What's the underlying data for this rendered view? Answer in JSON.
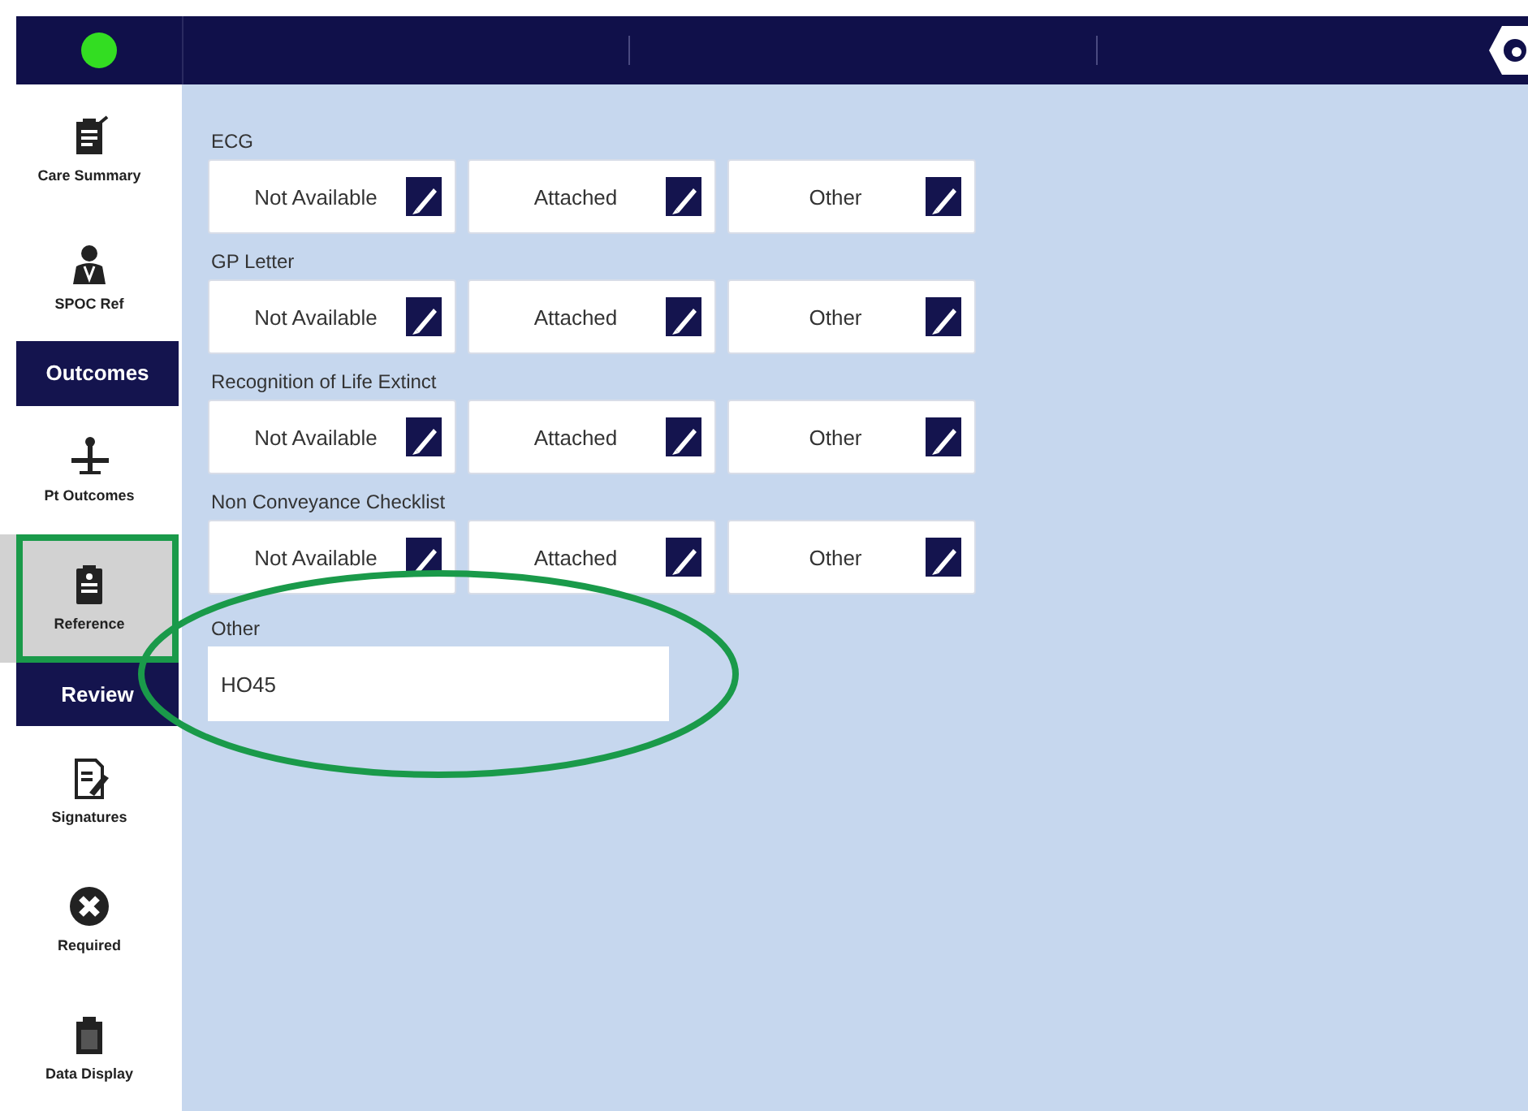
{
  "header": {
    "status_on": true
  },
  "sidebar": {
    "items": [
      {
        "kind": "item",
        "label": "Care Summary",
        "selected": false,
        "circled": false
      },
      {
        "kind": "item",
        "label": "SPOC Ref",
        "selected": false,
        "circled": false
      },
      {
        "kind": "header",
        "label": "Outcomes"
      },
      {
        "kind": "item",
        "label": "Pt Outcomes",
        "selected": false,
        "circled": false
      },
      {
        "kind": "item",
        "label": "Reference",
        "selected": true,
        "circled": true
      },
      {
        "kind": "header",
        "label": "Review"
      },
      {
        "kind": "item",
        "label": "Signatures",
        "selected": false,
        "circled": false
      },
      {
        "kind": "item",
        "label": "Required",
        "selected": false,
        "circled": false
      },
      {
        "kind": "item",
        "label": "Data Display",
        "selected": false,
        "circled": false
      }
    ]
  },
  "sections": [
    {
      "label": "ECG",
      "options": [
        "Not Available",
        "Attached",
        "Other"
      ]
    },
    {
      "label": "GP Letter",
      "options": [
        "Not Available",
        "Attached",
        "Other"
      ]
    },
    {
      "label": "Recognition of Life Extinct",
      "options": [
        "Not Available",
        "Attached",
        "Other"
      ]
    },
    {
      "label": "Non Conveyance Checklist",
      "options": [
        "Not Available",
        "Attached",
        "Other"
      ]
    }
  ],
  "other_field": {
    "label": "Other",
    "value": "HO45",
    "circled": true
  }
}
